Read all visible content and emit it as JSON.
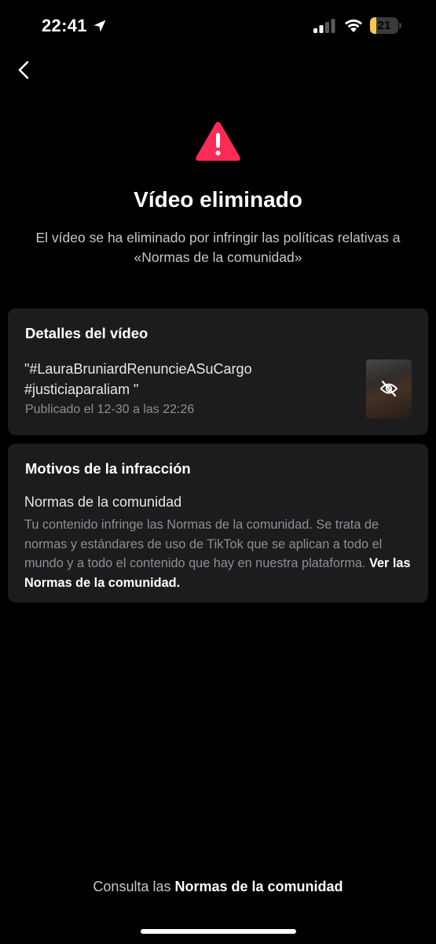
{
  "status_bar": {
    "time": "22:41",
    "battery_level": "21",
    "battery_fraction": 0.21,
    "battery_color": "#f2c94c",
    "icons": [
      "location-arrow-icon",
      "cellular-signal-icon",
      "wifi-icon",
      "battery-icon"
    ]
  },
  "nav": {
    "back_icon": "chevron-left-icon"
  },
  "header": {
    "icon": "warning-triangle-icon",
    "icon_color": "#fe2c55",
    "title": "Vídeo eliminado",
    "subtitle": "El vídeo se ha eliminado por infringir las políticas relativas a «Normas de la comunidad»"
  },
  "video_details": {
    "title": "Detalles del vídeo",
    "caption": "\"#LauraBruniardRenuncieASuCargo #justiciaparaliam \"",
    "published": "Publicado el 12-30 a las 22:26",
    "thumbnail_icon": "eye-off-icon"
  },
  "violation": {
    "title": "Motivos de la infracción",
    "reason_title": "Normas de la comunidad",
    "reason_text": "Tu contenido infringe las Normas de la comunidad. Se trata de normas y estándares de uso de TikTok que se aplican a todo el mundo y a todo el contenido que hay en nuestra plataforma.",
    "reason_link": "Ver las Normas de la comunidad."
  },
  "footer": {
    "prefix": "Consulta las",
    "link": "Normas de la comunidad"
  },
  "colors": {
    "background": "#000000",
    "card": "#1c1c1e",
    "muted_text": "#8e8e93"
  }
}
